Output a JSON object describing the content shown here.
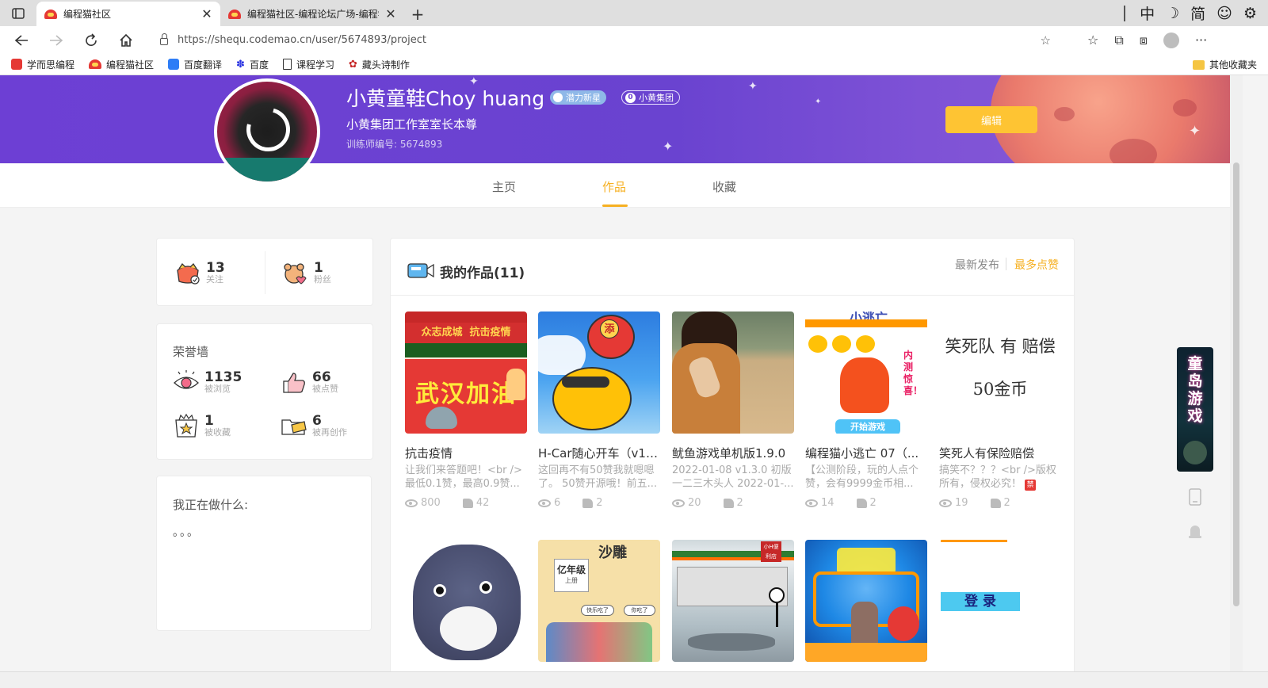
{
  "browser": {
    "tabs": [
      {
        "title": "编程猫社区",
        "active": true
      },
      {
        "title": "编程猫社区-编程论坛广场-编程学",
        "active": false
      }
    ],
    "right_icons": [
      "中",
      "☽",
      "简",
      "☺",
      "⚙"
    ],
    "url": "https://shequ.codemao.cn/user/5674893/project",
    "bookmarks": [
      "学而思编程",
      "编程猫社区",
      "百度翻译",
      "百度",
      "课程学习",
      "藏头诗制作"
    ],
    "other_bookmarks": "其他收藏夹",
    "accent": "#f6b022"
  },
  "profile": {
    "name": "小黄童鞋Choy huang",
    "badge_potential": "潜力新星",
    "badge_group": "小黄集团",
    "badge_group_count": "0",
    "signature": "小黄集团工作室室长本尊",
    "trainer_id": "训练师编号: 5674893",
    "edit_label": "编辑"
  },
  "tabs": {
    "home": "主页",
    "works": "作品",
    "favorites": "收藏"
  },
  "social": {
    "follow_count": "13",
    "follow_label": "关注",
    "fans_count": "1",
    "fans_label": "粉丝"
  },
  "honor": {
    "title": "荣誉墙",
    "views_count": "1135",
    "views_label": "被浏览",
    "likes_count": "66",
    "likes_label": "被点赞",
    "fav_count": "1",
    "fav_label": "被收藏",
    "remix_count": "6",
    "remix_label": "被再创作"
  },
  "doing": {
    "title": "我正在做什么:",
    "text": "。。。"
  },
  "works": {
    "title": "我的作品(11)",
    "sort_latest": "最新发布",
    "sort_most_liked": "最多点赞",
    "items": [
      {
        "title": "抗击疫情",
        "desc": "让我们来答题吧！<br />最低0.1赞，最高0.9赞...",
        "views": "800",
        "likes": "42"
      },
      {
        "title": "H-Car随心开车（v1....",
        "desc": "这回再不有50赞我就嗯嗯了。 50赞开源哦！前五...",
        "views": "6",
        "likes": "2"
      },
      {
        "title": "鱿鱼游戏单机版1.9.0",
        "desc": "2022-01-08 v1.3.0 初版 一二三木头人 2022-01-...",
        "views": "20",
        "likes": "2"
      },
      {
        "title": "编程猫小逃亡 07（...",
        "desc": "【公测阶段，玩的人点个赞，会有9999金币相...",
        "views": "14",
        "likes": "2"
      },
      {
        "title": "笑死人有保险赔偿",
        "desc": "搞笑不？？？<br />版权所有，侵权必究！",
        "views": "19",
        "likes": "2"
      }
    ],
    "thumb_text": {
      "t1_banner": "众志成城  抗击疫情",
      "t1_big": "武汉加油",
      "t2_badge": "添",
      "t4_top": "小逃亡",
      "t4_side": "内测惊喜！",
      "t4_button": "开始游戏",
      "t5_line1": "笑死队 有 赔偿",
      "t5_line2": "50金币",
      "t7_title": "沙雕",
      "t7_grade": "亿年级",
      "t7_grade_sub": "上册",
      "t7_bubble1": "快乐吃了",
      "t7_bubble2": "你吃了",
      "t8_sign": "小H便利店",
      "t10_login": "登 录"
    }
  },
  "side_app": {
    "label": "童岛游戏"
  }
}
